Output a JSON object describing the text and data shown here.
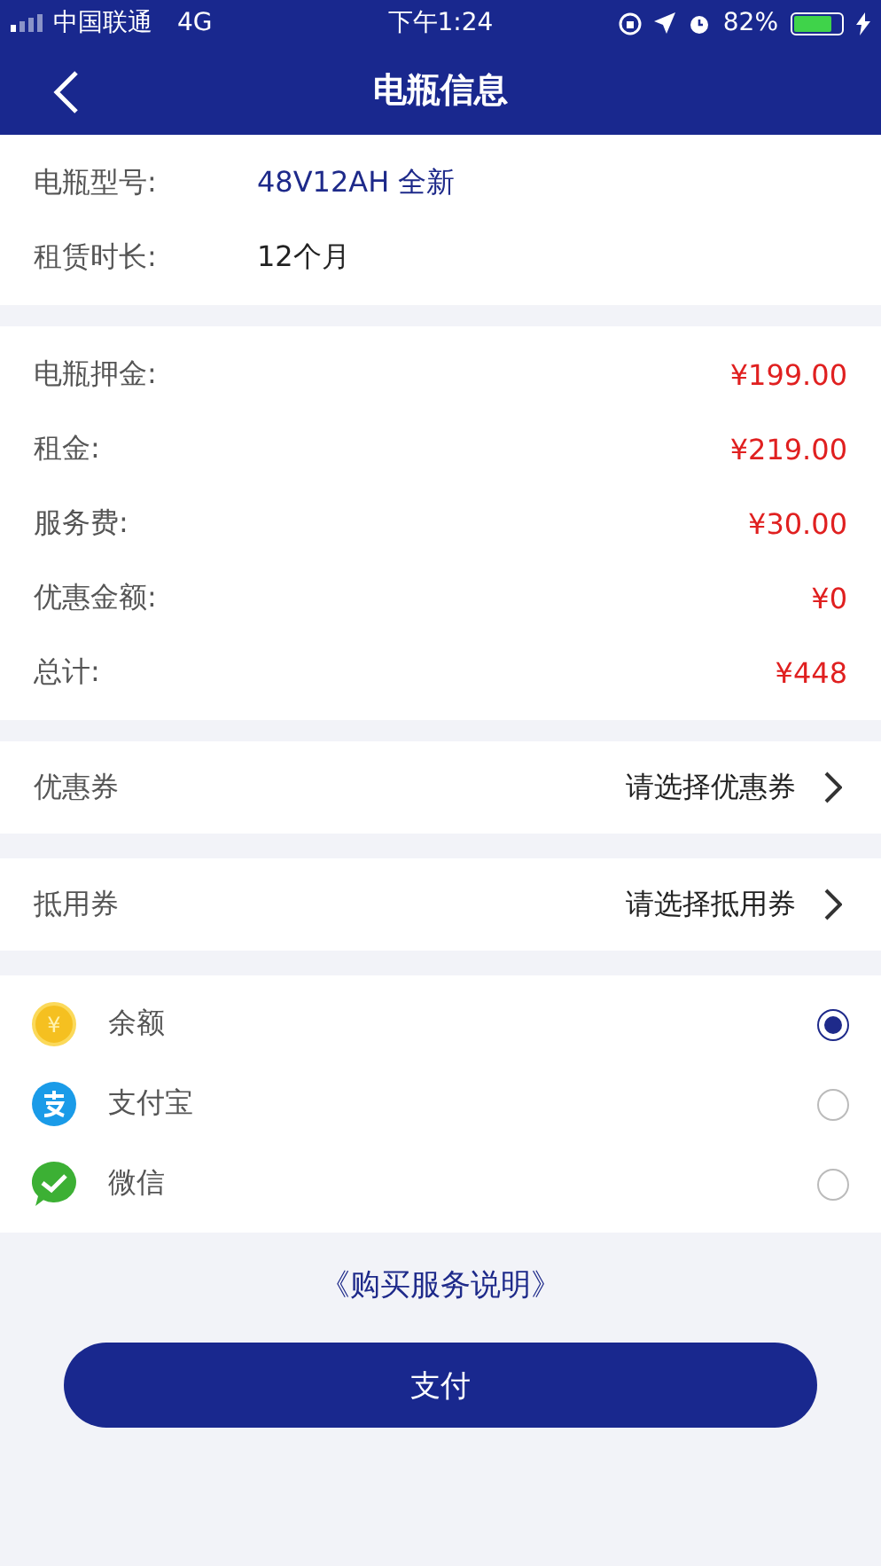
{
  "status_bar": {
    "carrier": "中国联通",
    "network": "4G",
    "time": "下午1:24",
    "battery": "82%"
  },
  "nav": {
    "title": "电瓶信息"
  },
  "info": [
    {
      "label": "电瓶型号:",
      "value": "48V12AH 全新",
      "highlight": true
    },
    {
      "label": "租赁时长:",
      "value": "12个月",
      "highlight": false
    }
  ],
  "charges": [
    {
      "label": "电瓶押金:",
      "value": "¥199.00"
    },
    {
      "label": "租金:",
      "value": "¥219.00"
    },
    {
      "label": "服务费:",
      "value": "¥30.00"
    },
    {
      "label": "优惠金额:",
      "value": "¥0"
    },
    {
      "label": "总计:",
      "value": "¥448"
    }
  ],
  "vouchers": [
    {
      "label": "优惠券",
      "value": "请选择优惠券"
    },
    {
      "label": "抵用券",
      "value": "请选择抵用券"
    }
  ],
  "payments": [
    {
      "kind": "balance",
      "symbol": "¥",
      "label": "余额",
      "selected": true
    },
    {
      "kind": "alipay",
      "label": "支付宝",
      "selected": false
    },
    {
      "kind": "wechat",
      "label": "微信",
      "selected": false
    }
  ],
  "terms_link": "《购买服务说明》",
  "pay_button": "支付"
}
